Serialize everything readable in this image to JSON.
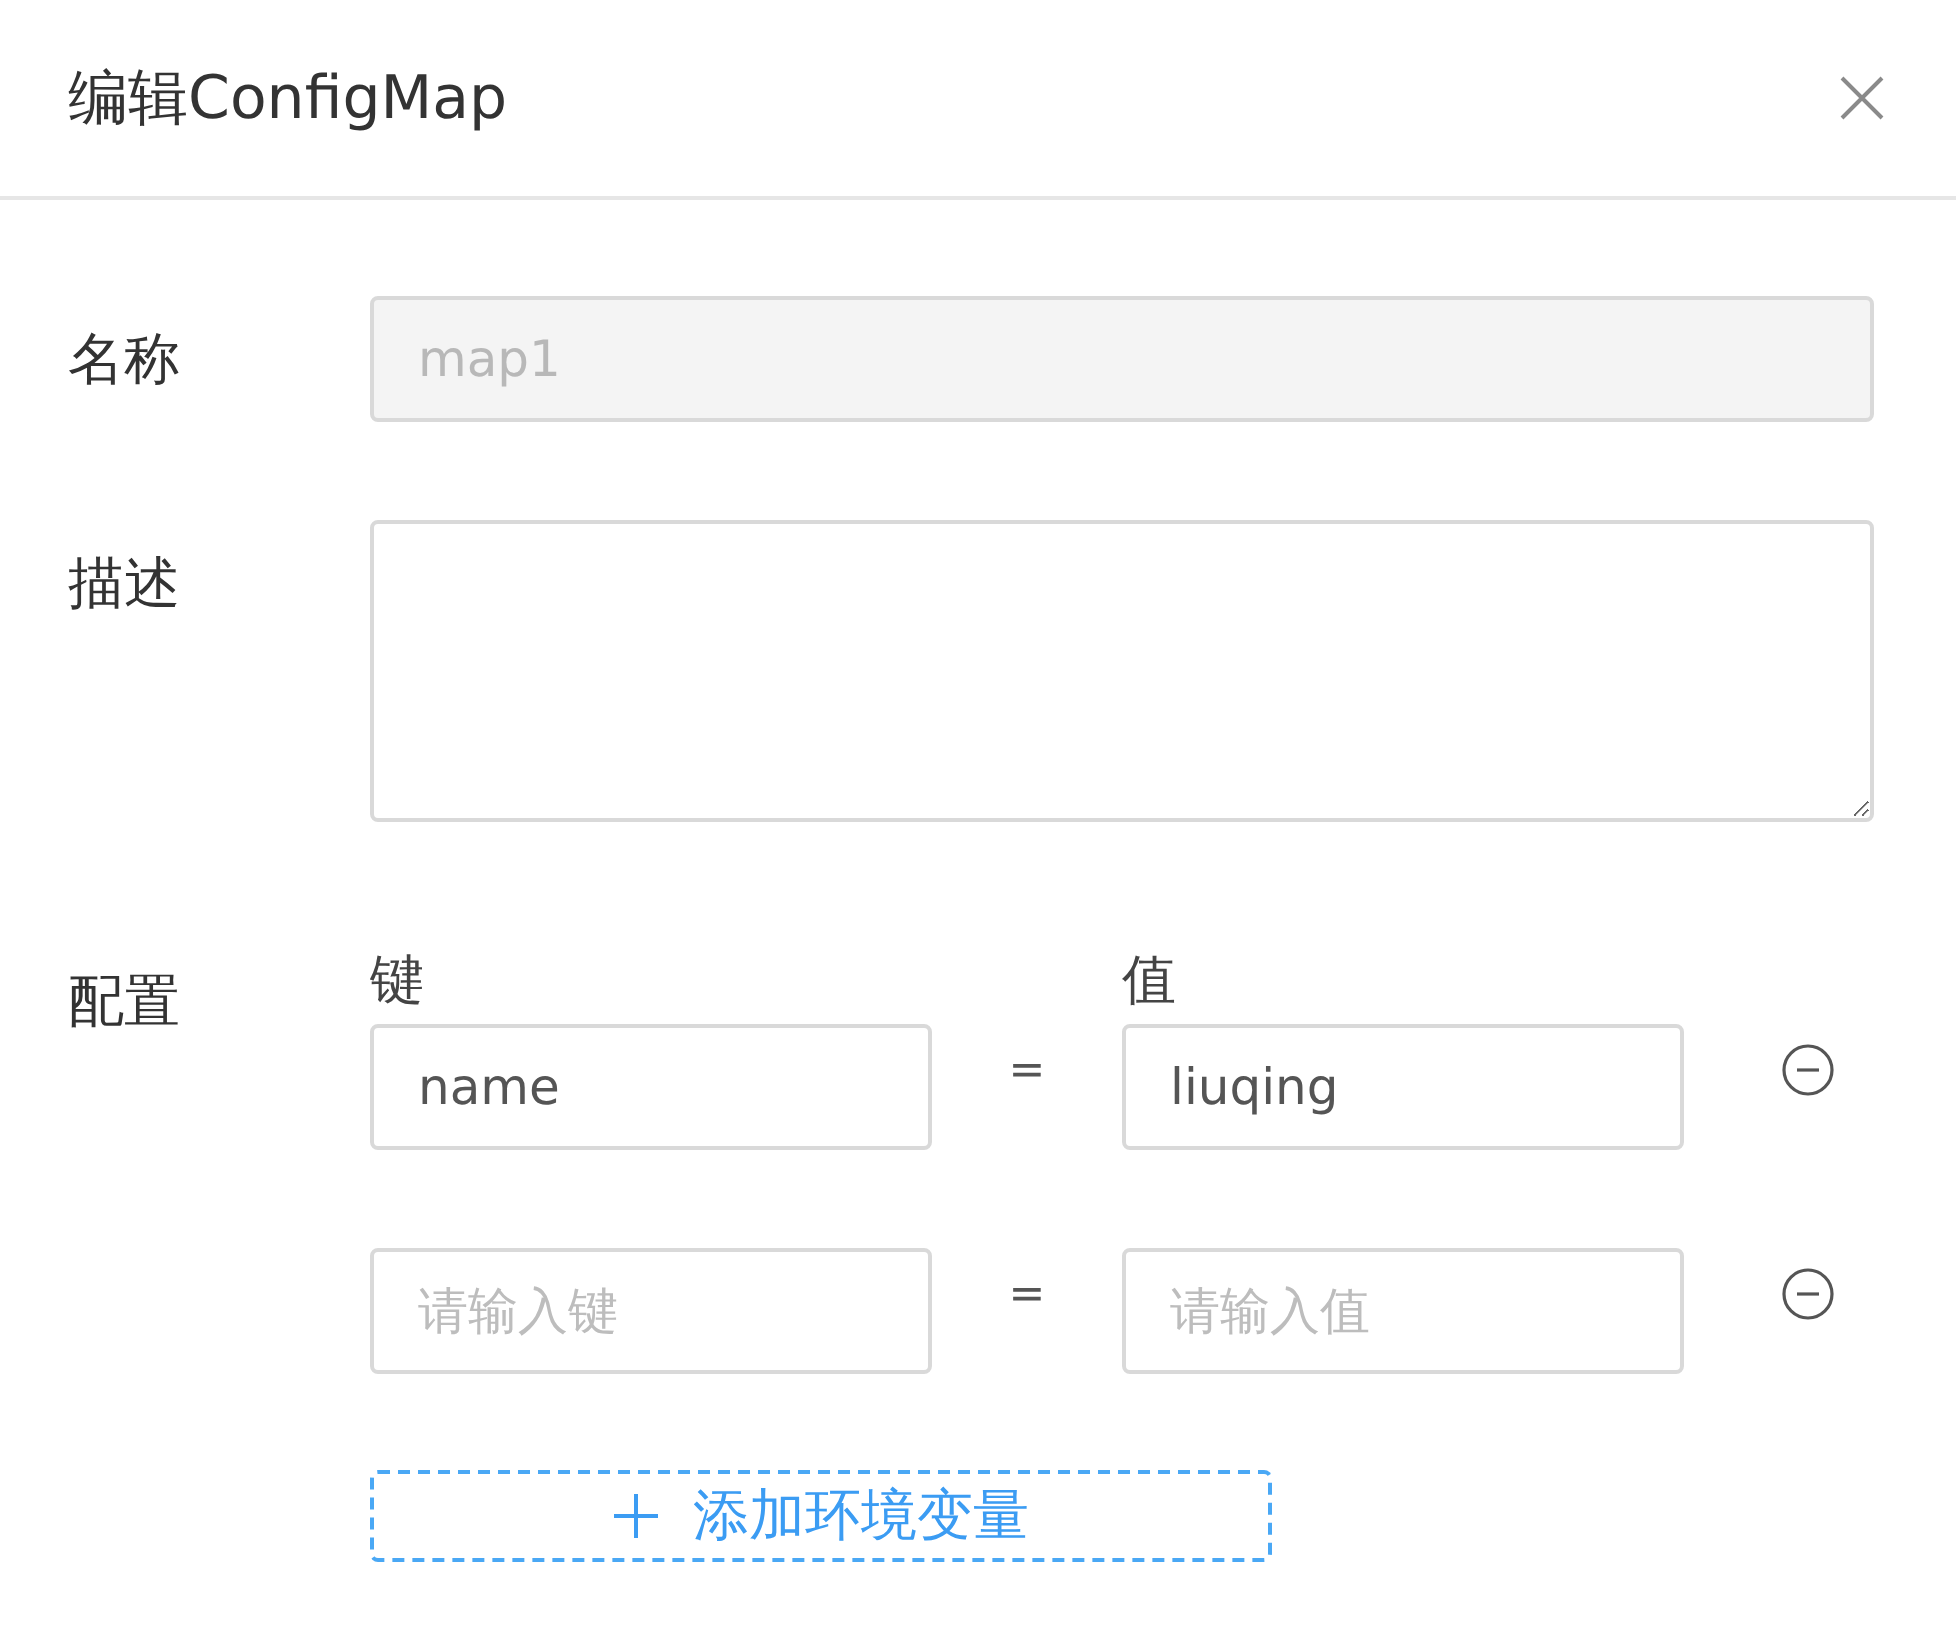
{
  "dialog": {
    "title": "编辑ConfigMap"
  },
  "form": {
    "name": {
      "label": "名称",
      "value": "map1",
      "disabled": true
    },
    "description": {
      "label": "描述"
    },
    "config": {
      "label": "配置",
      "key_header": "键",
      "value_header": "值",
      "rows": [
        {
          "key": {
            "value": "name"
          },
          "separator": "=",
          "value": {
            "value": "liuqing"
          }
        },
        {
          "key": {
            "placeholder": "请输入键"
          },
          "separator": "=",
          "value": {
            "placeholder": "请输入值"
          }
        }
      ],
      "add_button": {
        "label": "添加环境变量"
      }
    }
  }
}
